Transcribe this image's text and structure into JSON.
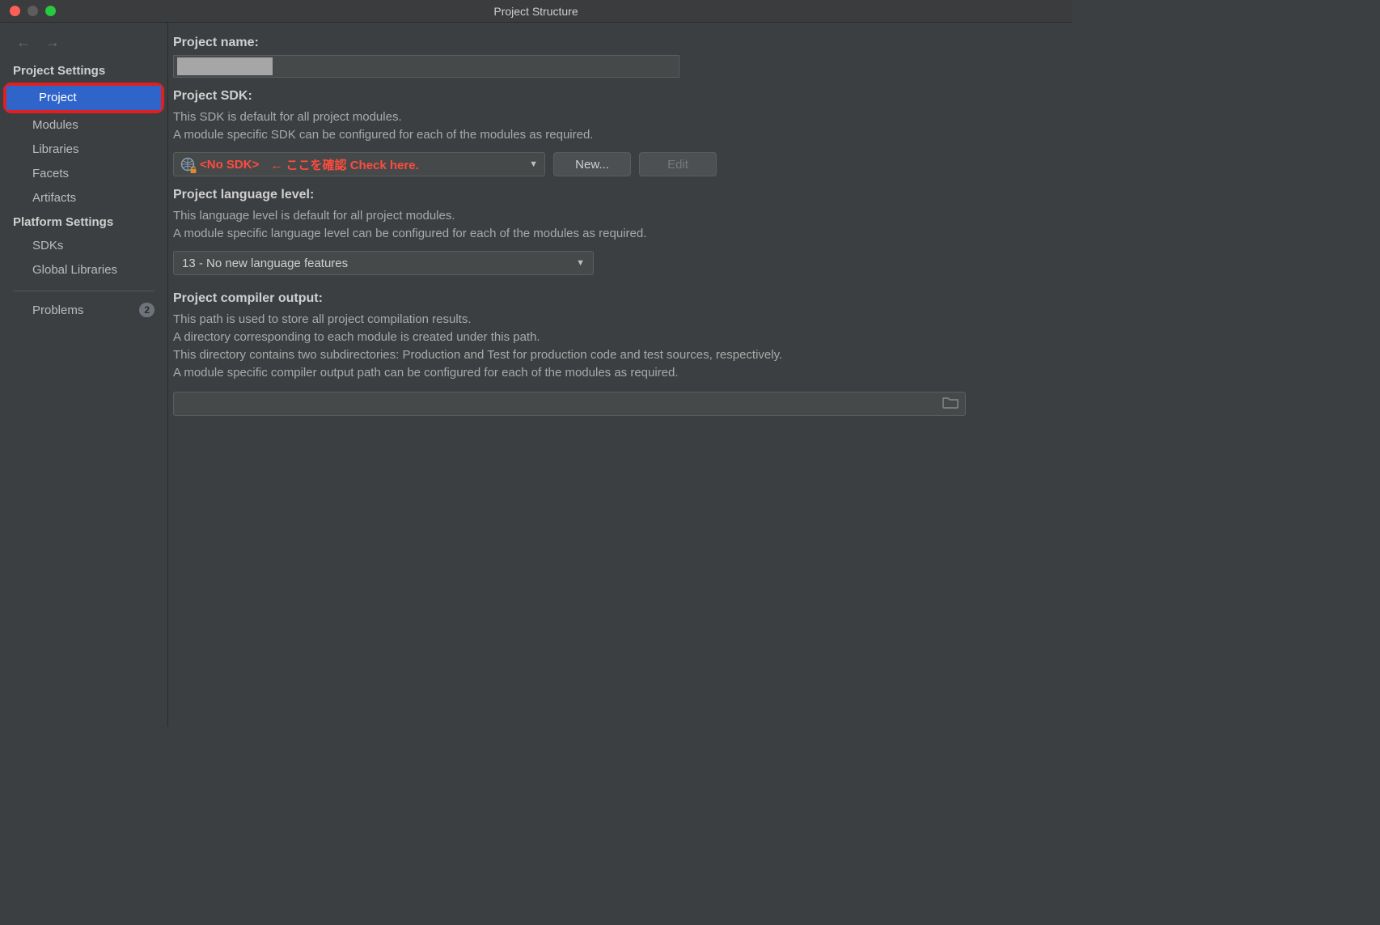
{
  "window": {
    "title": "Project Structure"
  },
  "sidebar": {
    "section1_title": "Project Settings",
    "section2_title": "Platform Settings",
    "items1": {
      "project": "Project",
      "modules": "Modules",
      "libraries": "Libraries",
      "facets": "Facets",
      "artifacts": "Artifacts"
    },
    "items2": {
      "sdks": "SDKs",
      "global_libraries": "Global Libraries"
    },
    "problems": {
      "label": "Problems",
      "count": "2"
    }
  },
  "content": {
    "project_name": {
      "label": "Project name:"
    },
    "project_sdk": {
      "label": "Project SDK:",
      "desc1": "This SDK is default for all project modules.",
      "desc2": "A module specific SDK can be configured for each of the modules as required.",
      "value": "<No SDK>",
      "annotation": "← ここを確認 Check here.",
      "new_btn": "New...",
      "edit_btn": "Edit"
    },
    "lang_level": {
      "label": "Project language level:",
      "desc1": "This language level is default for all project modules.",
      "desc2": "A module specific language level can be configured for each of the modules as required.",
      "value": "13 - No new language features"
    },
    "compiler_output": {
      "label": "Project compiler output:",
      "desc1": "This path is used to store all project compilation results.",
      "desc2": "A directory corresponding to each module is created under this path.",
      "desc3": "This directory contains two subdirectories: Production and Test for production code and test sources, respectively.",
      "desc4": "A module specific compiler output path can be configured for each of the modules as required."
    }
  }
}
